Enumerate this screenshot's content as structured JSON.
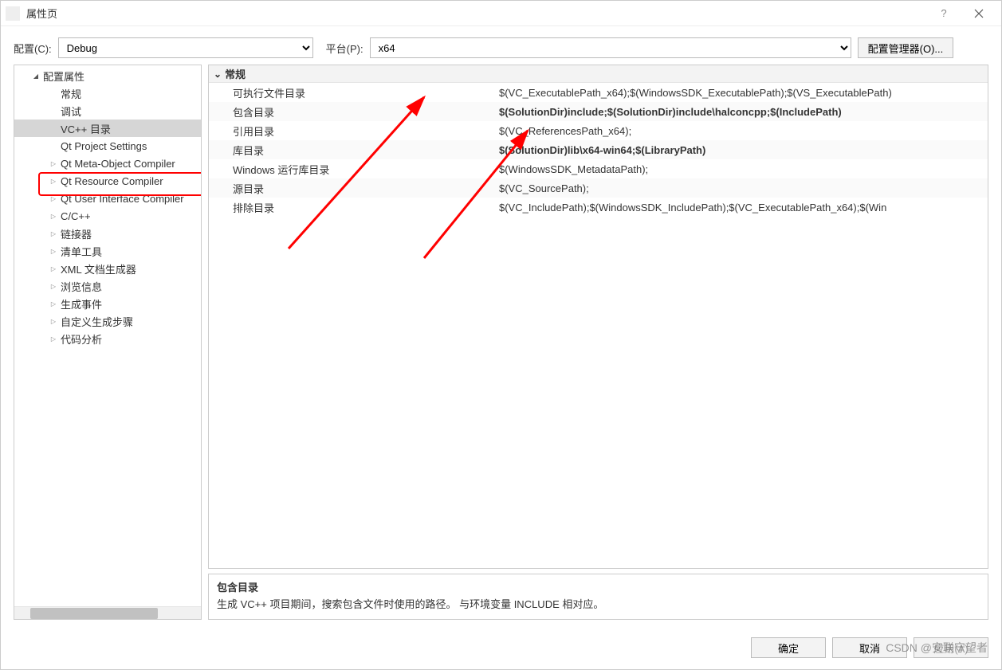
{
  "window": {
    "title": "属性页",
    "help": "?",
    "close": "×"
  },
  "top": {
    "config_label": "配置(C):",
    "config_value": "Debug",
    "platform_label": "平台(P):",
    "platform_value": "x64",
    "config_manager": "配置管理器(O)..."
  },
  "tree": {
    "root": "配置属性",
    "items": [
      {
        "label": "常规",
        "expander": "none"
      },
      {
        "label": "调试",
        "expander": "none"
      },
      {
        "label": "VC++ 目录",
        "expander": "none",
        "selected": true
      },
      {
        "label": "Qt Project Settings",
        "expander": "none"
      },
      {
        "label": "Qt Meta-Object Compiler",
        "expander": "collapsed"
      },
      {
        "label": "Qt Resource Compiler",
        "expander": "collapsed"
      },
      {
        "label": "Qt User Interface Compiler",
        "expander": "collapsed"
      },
      {
        "label": "C/C++",
        "expander": "collapsed"
      },
      {
        "label": "链接器",
        "expander": "collapsed"
      },
      {
        "label": "清单工具",
        "expander": "collapsed"
      },
      {
        "label": "XML 文档生成器",
        "expander": "collapsed"
      },
      {
        "label": "浏览信息",
        "expander": "collapsed"
      },
      {
        "label": "生成事件",
        "expander": "collapsed"
      },
      {
        "label": "自定义生成步骤",
        "expander": "collapsed"
      },
      {
        "label": "代码分析",
        "expander": "collapsed"
      }
    ]
  },
  "grid": {
    "group": "常规",
    "rows": [
      {
        "name": "可执行文件目录",
        "value": "$(VC_ExecutablePath_x64);$(WindowsSDK_ExecutablePath);$(VS_ExecutablePath)",
        "bold": false
      },
      {
        "name": "包含目录",
        "value": "$(SolutionDir)include;$(SolutionDir)include\\halconcpp;$(IncludePath)",
        "bold": true
      },
      {
        "name": "引用目录",
        "value": "$(VC_ReferencesPath_x64);",
        "bold": false
      },
      {
        "name": "库目录",
        "value": "$(SolutionDir)lib\\x64-win64;$(LibraryPath)",
        "bold": true
      },
      {
        "name": "Windows 运行库目录",
        "value": "$(WindowsSDK_MetadataPath);",
        "bold": false
      },
      {
        "name": "源目录",
        "value": "$(VC_SourcePath);",
        "bold": false
      },
      {
        "name": "排除目录",
        "value": "$(VC_IncludePath);$(WindowsSDK_IncludePath);$(VC_ExecutablePath_x64);$(Win",
        "bold": false
      }
    ]
  },
  "desc": {
    "title": "包含目录",
    "text": "生成 VC++ 项目期间，搜索包含文件时使用的路径。   与环境变量 INCLUDE 相对应。"
  },
  "footer": {
    "ok": "确定",
    "cancel": "取消",
    "apply": "应用(A)"
  },
  "watermark": "CSDN @安联守望者"
}
